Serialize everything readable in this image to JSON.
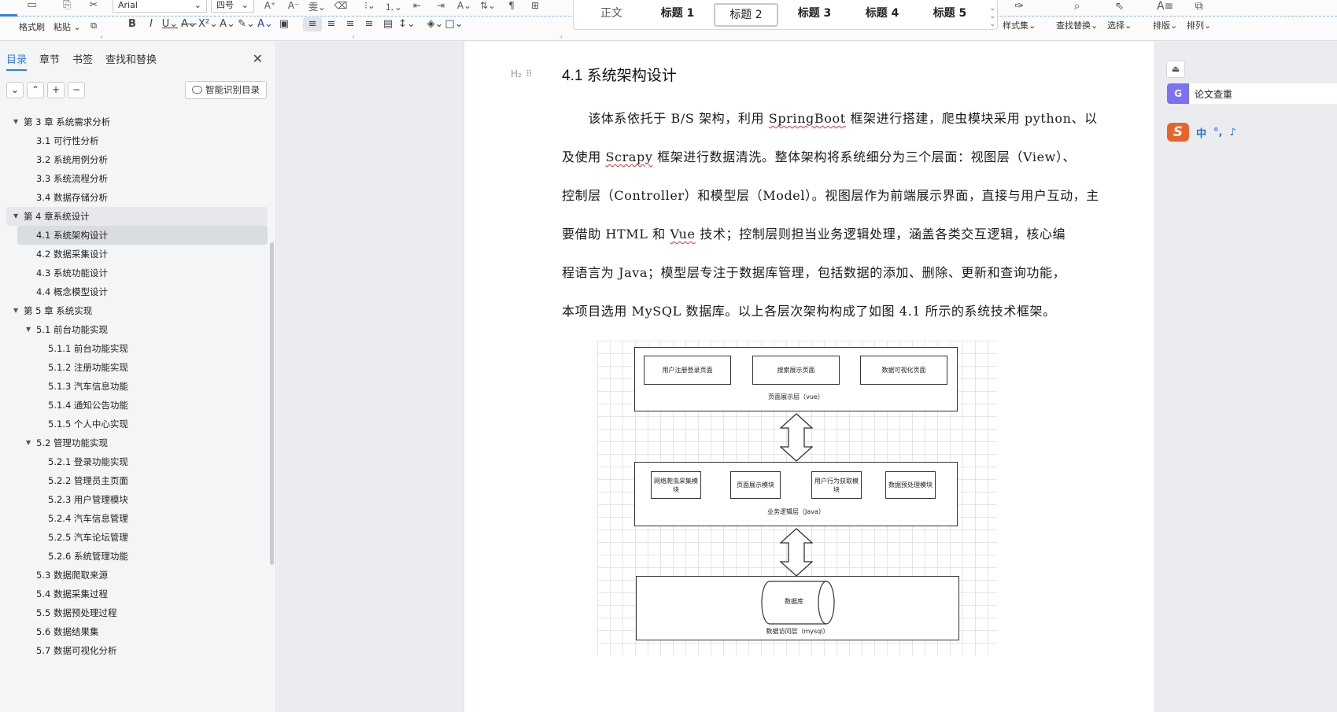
{
  "ribbon": {
    "format_painter": "格式刷",
    "paste": "粘贴",
    "font_name": "Arial",
    "font_size": "四号",
    "styles": [
      "正文",
      "标题 1",
      "标题 2",
      "标题 3",
      "标题 4",
      "标题 5"
    ],
    "active_style_index": 2,
    "style_set": "样式集",
    "find_replace": "查找替换",
    "select": "选择",
    "layout": "排版",
    "arrange": "排列",
    "dropdown_caret": "⌄"
  },
  "nav": {
    "tabs": [
      "目录",
      "章节",
      "书签",
      "查找和替换"
    ],
    "active_tab": 0,
    "smart_toc_button": "智能识别目录",
    "items": [
      {
        "text": "第 3 章  系统需求分析",
        "level": 1,
        "expanded": true
      },
      {
        "text": "3.1 可行性分析",
        "level": 2
      },
      {
        "text": "3.2 系统用例分析",
        "level": 2
      },
      {
        "text": "3.3 系统流程分析",
        "level": 2
      },
      {
        "text": "3.4 数据存储分析",
        "level": 2
      },
      {
        "text": "第 4 章系统设计",
        "level": 1,
        "expanded": true
      },
      {
        "text": "4.1 系统架构设计",
        "level": 2,
        "selected": true
      },
      {
        "text": "4.2 数据采集设计",
        "level": 2
      },
      {
        "text": "4.3 系统功能设计",
        "level": 2
      },
      {
        "text": "4.4 概念模型设计",
        "level": 2
      },
      {
        "text": "第 5 章  系统实现",
        "level": 1,
        "expanded": true
      },
      {
        "text": "5.1 前台功能实现",
        "level": 2,
        "expanded": true
      },
      {
        "text": "5.1.1 前台功能实现",
        "level": 3
      },
      {
        "text": "5.1.2 注册功能实现",
        "level": 3
      },
      {
        "text": "5.1.3 汽车信息功能",
        "level": 3
      },
      {
        "text": "5.1.4 通知公告功能",
        "level": 3
      },
      {
        "text": "5.1.5 个人中心实现",
        "level": 3
      },
      {
        "text": "5.2 管理功能实现",
        "level": 2,
        "expanded": true
      },
      {
        "text": "5.2.1 登录功能实现",
        "level": 3
      },
      {
        "text": "5.2.2 管理员主页面",
        "level": 3
      },
      {
        "text": "5.2.3 用户管理模块",
        "level": 3
      },
      {
        "text": "5.2.4 汽车信息管理",
        "level": 3
      },
      {
        "text": "5.2.5 汽车论坛管理",
        "level": 3
      },
      {
        "text": "5.2.6 系统管理功能",
        "level": 3
      },
      {
        "text": "5.3 数据爬取来源",
        "level": 2
      },
      {
        "text": "5.4 数据采集过程",
        "level": 2
      },
      {
        "text": "5.5 数据预处理过程",
        "level": 2
      },
      {
        "text": "5.6 数据结果集",
        "level": 2
      },
      {
        "text": "5.7 数据可视化分析",
        "level": 2
      }
    ]
  },
  "doc": {
    "heading": "4.1 系统架构设计",
    "heading_tag": "H₂",
    "lines": [
      [
        {
          "t": "　　该体系依托于 B/S 架构，利用 "
        },
        {
          "t": "SpringBoot",
          "sq": true
        },
        {
          "t": " 框架进行搭建，爬虫模块采用 python、以"
        }
      ],
      [
        {
          "t": "及使用 "
        },
        {
          "t": "Scrapy",
          "sq": true
        },
        {
          "t": " 框架进行数据清洗。整体架构将系统细分为三个层面：视图层（View）、"
        }
      ],
      [
        {
          "t": "控制层（Controller）和模型层（Model）。视图层作为前端展示界面，直接与用户互动，主"
        }
      ],
      [
        {
          "t": "要借助 HTML 和 "
        },
        {
          "t": "Vue",
          "sq": true
        },
        {
          "t": " 技术；控制层则担当业务逻辑处理，涵盖各类交互逻辑，核心编"
        }
      ],
      [
        {
          "t": "程语言为 Java；模型层专注于数据库管理，包括数据的添加、删除、更新和查询功能，"
        }
      ],
      [
        {
          "t": "本项目选用 MySQL 数据库。以上各层次架构构成了如图 4.1 所示的系统技术框架。"
        }
      ]
    ],
    "figure": {
      "layer1": {
        "caption": "页面展示层（vue）",
        "boxes": [
          "用户注册登录页面",
          "搜索展示页面",
          "数据可视化页面"
        ]
      },
      "layer2": {
        "caption": "业务逻辑层（Java）",
        "boxes": [
          "网络爬虫采集模块",
          "页面展示模块",
          "用户行为获取模块",
          "数据预处理模块"
        ]
      },
      "layer3": {
        "caption": "数据访问层（mysql）",
        "db": "数据库"
      }
    }
  },
  "right": {
    "plagiarism_check": "论文查重",
    "ime_cn": "中",
    "ime_punct": "°,"
  }
}
